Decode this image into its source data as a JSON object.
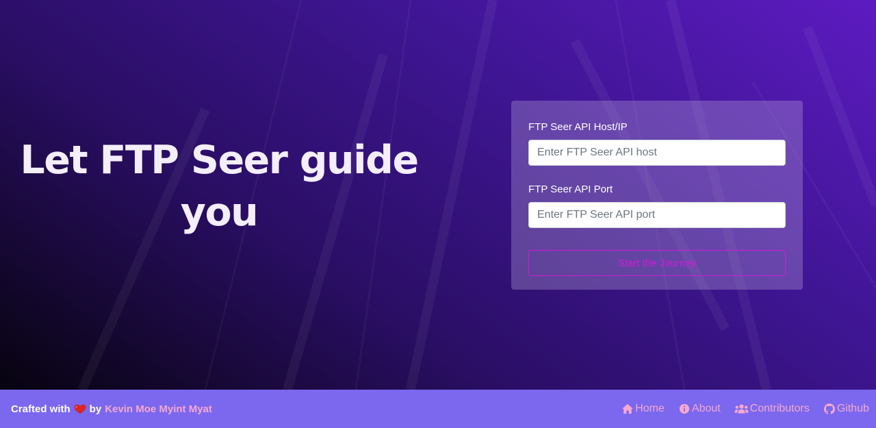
{
  "hero": {
    "title": "Let FTP Seer guide you"
  },
  "form": {
    "host_label": "FTP Seer API Host/IP",
    "host_placeholder": "Enter FTP Seer API host",
    "host_value": "",
    "port_label": "FTP Seer API Port",
    "port_placeholder": "Enter FTP Seer API port",
    "port_value": "",
    "submit_label": "Start the Journey"
  },
  "footer": {
    "crafted_with": "Crafted with",
    "by": "by",
    "author": "Kevin Moe Myint Myat",
    "heart_icon": "heart-icon",
    "nav": [
      {
        "label": "Home",
        "icon": "home-icon"
      },
      {
        "label": "About",
        "icon": "info-circle-icon"
      },
      {
        "label": "Contributors",
        "icon": "users-icon"
      },
      {
        "label": "Github",
        "icon": "github-icon"
      }
    ]
  },
  "colors": {
    "footer_bg": "#7b68ee",
    "link": "#f7a8cf",
    "button_accent": "#d21ad8",
    "hero_gradient_start": "#5d1bc1",
    "hero_gradient_end": "#07030f"
  }
}
